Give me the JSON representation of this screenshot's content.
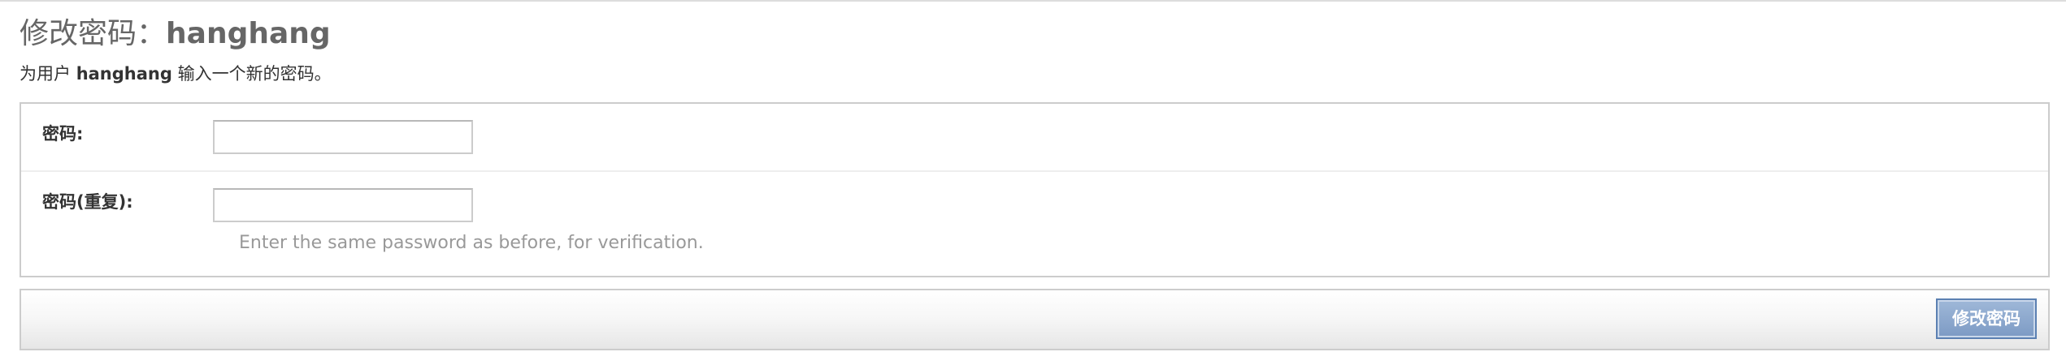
{
  "header": {
    "title_prefix": "修改密码：",
    "title_username": "hanghang"
  },
  "intro": {
    "before": "为用户 ",
    "username": "hanghang",
    "after": " 输入一个新的密码。"
  },
  "form": {
    "password": {
      "label": "密码:",
      "value": ""
    },
    "password_confirm": {
      "label": "密码(重复):",
      "value": "",
      "help_text": "Enter the same password as before, for verification."
    }
  },
  "submit": {
    "label": "修改密码"
  },
  "colors": {
    "title": "#666666",
    "button_border": "#5b80b2",
    "help_text": "#999999"
  }
}
